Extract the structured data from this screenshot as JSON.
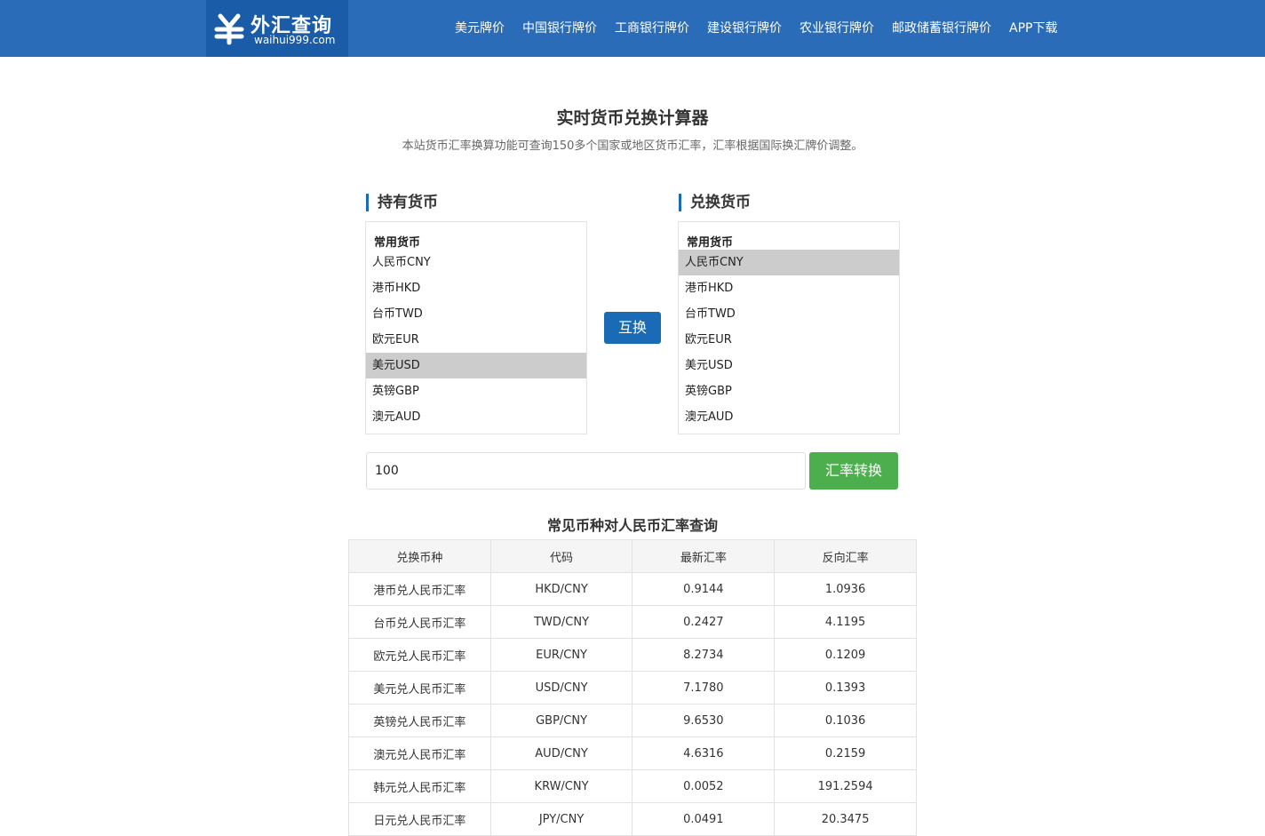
{
  "header": {
    "logo_title": "外汇查询",
    "logo_sub": "waihui999.com",
    "nav": [
      "美元牌价",
      "中国银行牌价",
      "工商银行牌价",
      "建设银行牌价",
      "农业银行牌价",
      "邮政储蓄银行牌价",
      "APP下载"
    ],
    "bg_color": "#2b6cb8"
  },
  "main": {
    "title": "实时货币兑换计算器",
    "description": "本站货币汇率换算功能可查询150多个国家或地区货币汇率，汇率根据国际换汇牌价调整。"
  },
  "from": {
    "label": "持有货币",
    "group": "常用货币",
    "options": [
      "人民币CNY",
      "港币HKD",
      "台币TWD",
      "欧元EUR",
      "美元USD",
      "英镑GBP",
      "澳元AUD"
    ],
    "selected": "美元USD"
  },
  "to": {
    "label": "兑换货币",
    "group": "常用货币",
    "options": [
      "人民币CNY",
      "港币HKD",
      "台币TWD",
      "欧元EUR",
      "美元USD",
      "英镑GBP",
      "澳元AUD"
    ],
    "selected": "人民币CNY"
  },
  "swap_label": "互换",
  "amount": "100",
  "convert_label": "汇率转换",
  "rates_table": {
    "title": "常见币种对人民币汇率查询",
    "headers": [
      "兑换币种",
      "代码",
      "最新汇率",
      "反向汇率"
    ],
    "rows": [
      [
        "港币兑人民币汇率",
        "HKD/CNY",
        "0.9144",
        "1.0936"
      ],
      [
        "台币兑人民币汇率",
        "TWD/CNY",
        "0.2427",
        "4.1195"
      ],
      [
        "欧元兑人民币汇率",
        "EUR/CNY",
        "8.2734",
        "0.1209"
      ],
      [
        "美元兑人民币汇率",
        "USD/CNY",
        "7.1780",
        "0.1393"
      ],
      [
        "英镑兑人民币汇率",
        "GBP/CNY",
        "9.6530",
        "0.1036"
      ],
      [
        "澳元兑人民币汇率",
        "AUD/CNY",
        "4.6316",
        "0.2159"
      ],
      [
        "韩元兑人民币汇率",
        "KRW/CNY",
        "0.0052",
        "191.2594"
      ],
      [
        "日元兑人民币汇率",
        "JPY/CNY",
        "0.0491",
        "20.3475"
      ]
    ]
  }
}
